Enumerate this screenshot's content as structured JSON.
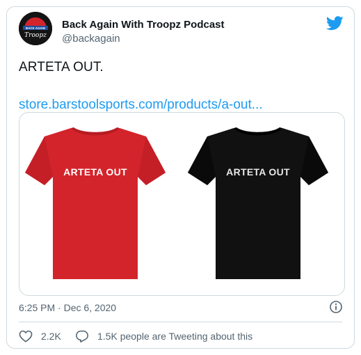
{
  "author": {
    "name": "Back Again With Troopz Podcast",
    "handle": "@backagain",
    "avatar_text_top": "BACK AGAIN",
    "avatar_text_bottom": "Troopz"
  },
  "tweet": {
    "text": "ARTETA OUT.",
    "link": "store.barstoolsports.com/products/a-out..."
  },
  "media": {
    "shirts": [
      {
        "color": "#d4242b",
        "print": "ARTETA OUT",
        "print_color": "#ffffff"
      },
      {
        "color": "#111111",
        "print": "ARTETA OUT",
        "print_color": "#e8e8e8"
      }
    ]
  },
  "footer": {
    "timestamp": "6:25 PM · Dec 6, 2020",
    "likes": "2.2K",
    "tweeting": "1.5K people are Tweeting about this"
  },
  "colors": {
    "accent": "#1d9bf0",
    "text": "#0f1419",
    "muted": "#536471",
    "border": "#cfd9de"
  },
  "icons": [
    "twitter-bird-icon",
    "info-icon",
    "heart-icon",
    "reply-icon"
  ]
}
